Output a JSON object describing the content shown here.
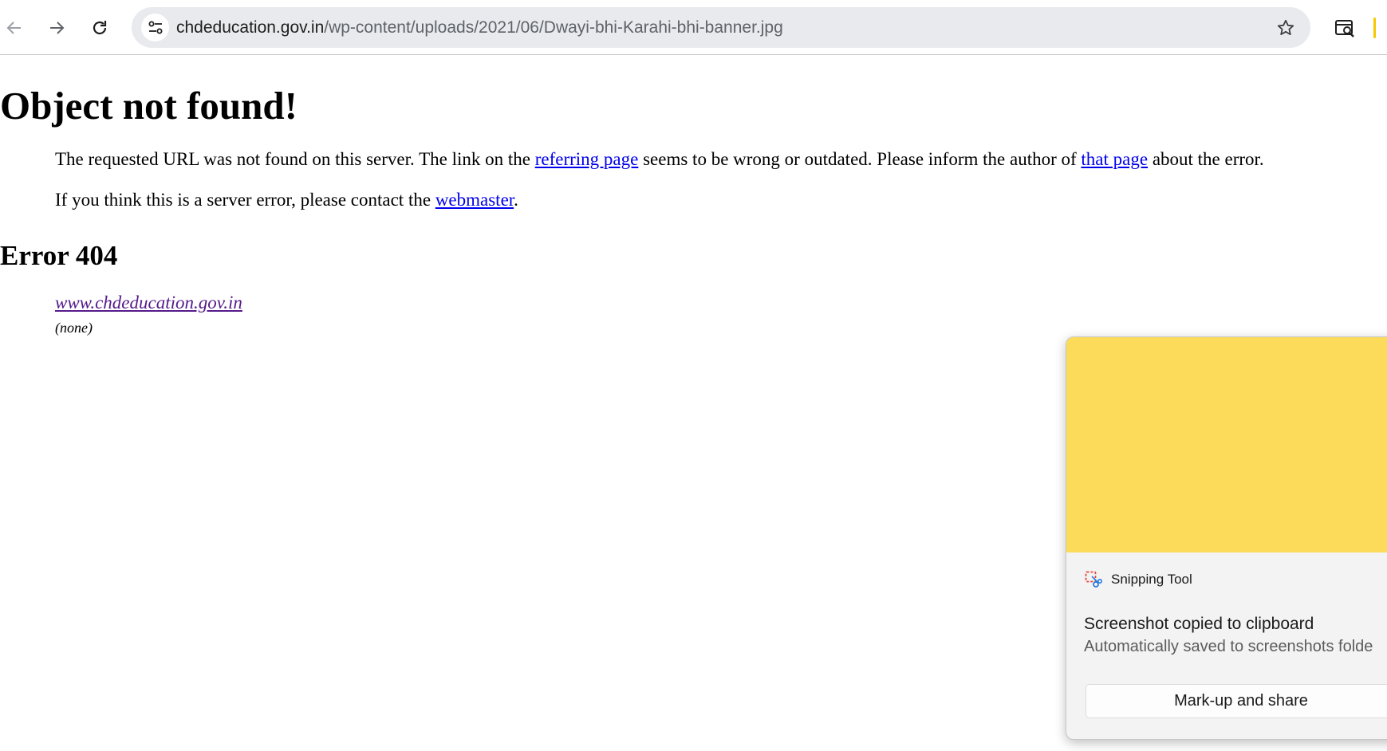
{
  "browser": {
    "host": "chdeducation.gov.in",
    "path": "/wp-content/uploads/2021/06/Dwayi-bhi-Karahi-bhi-banner.jpg",
    "icons": {
      "back": "arrow-left-icon",
      "forward": "arrow-right-icon",
      "reload": "reload-icon",
      "site_info": "tune-icon",
      "bookmark": "star-icon",
      "lens": "lens-search-icon"
    },
    "accent_color": "#f5c800"
  },
  "page": {
    "title": "Object not found!",
    "paragraph1": {
      "before_link1": "The requested URL was not found on this server. The link on the ",
      "link1": "referring page",
      "between_links": " seems to be wrong or outdated. Please inform the author of ",
      "link2": "that page",
      "after_link2": " about the error."
    },
    "paragraph2": {
      "before_link": "If you think this is a server error, please contact the ",
      "link": "webmaster",
      "after_link": "."
    },
    "error_heading": "Error 404",
    "address_link": "www.chdeducation.gov.in",
    "address_note": "(none)",
    "link_color": "#0000ee",
    "visited_link_color": "#551a8b"
  },
  "notification": {
    "app_name": "Snipping Tool",
    "app_icon": "snipping-tool-icon",
    "title": "Screenshot copied to clipboard",
    "subtitle": "Automatically saved to screenshots folde",
    "button_label": "Mark-up and share",
    "preview_color": "#fcdb5a"
  }
}
